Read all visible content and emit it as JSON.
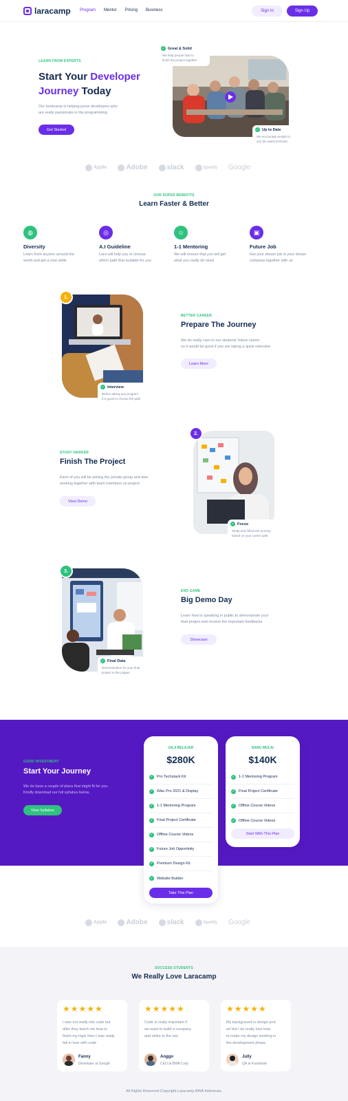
{
  "header": {
    "logo": "laracamp",
    "nav": [
      "Program",
      "Mentor",
      "Pricing",
      "Business"
    ],
    "sign_in": "Sign In",
    "sign_up": "Sign Up"
  },
  "hero": {
    "eyebrow": "LEARN FROM EXPERTS",
    "title_1": "Start Your ",
    "title_highlight": "Developer",
    "title_2": "Journey",
    "title_3": " Today",
    "desc_1": "Our bootcamp is helping junior developers who",
    "desc_2": "are really passionate in the programming.",
    "cta": "Get Started",
    "tag_top_title": "Great & Solid",
    "tag_top_sub_1": "We help people how to",
    "tag_top_sub_2": "finish the project together",
    "tag_bottom_title": "Up to Date",
    "tag_bottom_sub_1": "We encourage people to",
    "tag_bottom_sub_2": "use the latest technolo"
  },
  "brands": [
    "Apple",
    "Adobe",
    "slack",
    "Spotify",
    "Google"
  ],
  "benefits": {
    "eyebrow": "OUR SUPER BENEFITS",
    "title": "Learn Faster & Better",
    "items": [
      {
        "title": "Diversity",
        "d1": "Learn from anyone around the",
        "d2": "world and get a new skills",
        "color": "#2ec27e",
        "icon": "globe-icon"
      },
      {
        "title": "A.I Guideline",
        "d1": "Lara will help you to choose",
        "d2": "which path that suitable for you",
        "color": "#6a2ee8",
        "icon": "target-icon"
      },
      {
        "title": "1-1 Mentoring",
        "d1": "We will ensure that you will get",
        "d2": "what you really do need",
        "color": "#2ec27e",
        "icon": "user-icon"
      },
      {
        "title": "Future Job",
        "d1": "Get your dream job in your dream",
        "d2": "company together with us",
        "color": "#6a2ee8",
        "icon": "briefcase-icon"
      }
    ]
  },
  "steps": [
    {
      "badge": "1.",
      "eyebrow": "BETTER CAREER",
      "title": "Prepare The Journey",
      "d1": "We do really care to our students' future career",
      "d2": "so it would be good if you are taking a quick interview",
      "button": "Learn More",
      "tag_title": "Interview",
      "tag_sub_1": "Before taking any program",
      "tag_sub_2": "it is good to choose the path"
    },
    {
      "badge": "2.",
      "eyebrow": "STUDY HARDER",
      "title": "Finish The Project",
      "d1": "Each of you will be joining the private group and also",
      "d2": "working together with team members on project",
      "button": "View Demo",
      "tag_title": "Focus",
      "tag_sub_1": "Study and follow the journey",
      "tag_sub_2": "based on your career path"
    },
    {
      "badge": "3.",
      "eyebrow": "END GAME",
      "title": "Big Demo Day",
      "d1": "Learn how to speaking in public to demonstrate your",
      "d2": "final project and receive the important feedbacks",
      "button": "Showcase",
      "tag_title": "Final Data",
      "tag_sub_1": "Demonstration for your final",
      "tag_sub_2": "project to the judges"
    }
  ],
  "pricing": {
    "eyebrow": "GOOD INVESTMENT",
    "title": "Start Your Journey",
    "d1": "We do have a couple of plans that might fit for you.",
    "d2": "Kindly download our full syllabus below.",
    "cta": "View Syllabus",
    "plans": [
      {
        "label": "GILA BELAJAR",
        "price": "$280K",
        "features": [
          "Pro Techstack Kit",
          "iMac Pro 2021 & Display",
          "1-1 Mentoring Program",
          "Final Project Certificate",
          "Offline Course Videos",
          "Future Job Opportinity",
          "Premium Design Kit",
          "Website Builder"
        ],
        "button": "Take This Plan"
      },
      {
        "label": "BARU MULAI",
        "price": "$140K",
        "features": [
          "1-1 Mentoring Program",
          "Final Project Certificate",
          "Offline Course Videos",
          "Offline Course Videos"
        ],
        "button": "Start With This Plan"
      }
    ]
  },
  "testimonials": {
    "eyebrow": "SUCCESS STUDENTS",
    "title": "We Really Love Laracamp",
    "stars": "★★★★★",
    "items": [
      {
        "l1": "I was not really into code but",
        "l2": "after they teach me how to",
        "l3": "finish my logic then I was really",
        "l4": "fall in love with code",
        "name": "Fanny",
        "role": "Developer at Google"
      },
      {
        "l1": "Code is really important if",
        "l2": "we want to build a company",
        "l3": "and strike to the win",
        "l4": "",
        "name": "Anggo",
        "role": "CEO at BWA Corp"
      },
      {
        "l1": "My background is design and",
        "l2": "art but I do really love how",
        "l3": "to make my design working in",
        "l4": "the development phase",
        "name": "Jully",
        "role": "QA at Facebook"
      }
    ]
  },
  "footer": "All Rights Reserved Copyright Laracamp BWA Indonesia."
}
